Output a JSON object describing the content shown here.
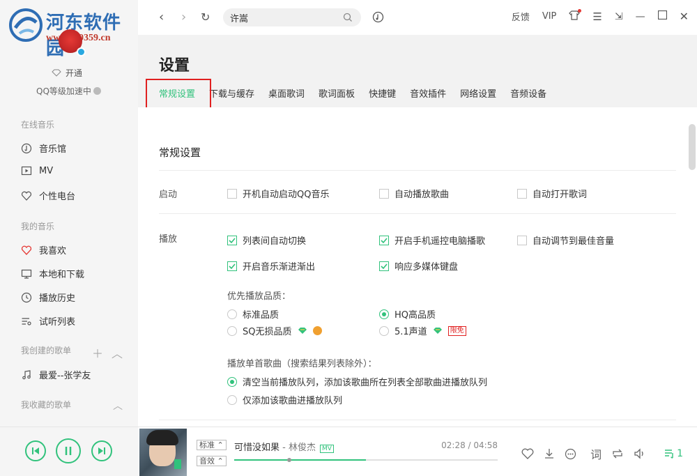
{
  "watermark": {
    "title": "河东软件园",
    "url": "www.pc0359.cn"
  },
  "sidebar": {
    "open_vip": "开通",
    "qq_speed": "QQ等级加速中",
    "section_online": "在线音乐",
    "online_items": [
      {
        "label": "音乐馆",
        "icon": "music-hall-icon"
      },
      {
        "label": "MV",
        "icon": "mv-icon"
      },
      {
        "label": "个性电台",
        "icon": "radio-icon"
      }
    ],
    "section_my": "我的音乐",
    "my_items": [
      {
        "label": "我喜欢",
        "icon": "heart-icon"
      },
      {
        "label": "本地和下载",
        "icon": "monitor-icon"
      },
      {
        "label": "播放历史",
        "icon": "clock-icon"
      },
      {
        "label": "试听列表",
        "icon": "list-icon"
      }
    ],
    "section_created": "我创建的歌单",
    "created_items": [
      {
        "label": "最爱--张学友",
        "icon": "note-icon"
      }
    ],
    "section_collected": "我收藏的歌单"
  },
  "topbar": {
    "search_value": "许嵩",
    "feedback": "反馈",
    "vip": "VIP"
  },
  "settings": {
    "title": "设置",
    "tabs": [
      "常规设置",
      "下载与缓存",
      "桌面歌词",
      "歌词面板",
      "快捷键",
      "音效插件",
      "网络设置",
      "音频设备"
    ],
    "section_title": "常规设置",
    "startup_label": "启动",
    "startup_opts": [
      "开机自动启动QQ音乐",
      "自动播放歌曲",
      "自动打开歌词"
    ],
    "play_label": "播放",
    "play_opts": [
      "列表间自动切换",
      "开启手机遥控电脑播歌",
      "自动调节到最佳音量",
      "开启音乐渐进渐出",
      "响应多媒体键盘"
    ],
    "quality_label": "优先播放品质：",
    "quality_opts": [
      "标准品质",
      "HQ高品质",
      "SQ无损品质",
      "5.1声道"
    ],
    "limit_free": "限免",
    "double_click_label": "播放单首歌曲（搜索结果列表除外）：",
    "double_click_opts": [
      "清空当前播放队列，添加该歌曲所在列表全部歌曲进播放队列",
      "仅添加该歌曲进播放队列"
    ]
  },
  "player": {
    "quality_btn": "标准",
    "effect_btn": "音效",
    "song": "可惜没如果",
    "artist": " - 林俊杰",
    "mv": "MV",
    "time": "02:28 / 04:58",
    "progress": 0.5,
    "lyric_btn": "词",
    "playlist_count": "1",
    "accent": "#31c27c"
  }
}
